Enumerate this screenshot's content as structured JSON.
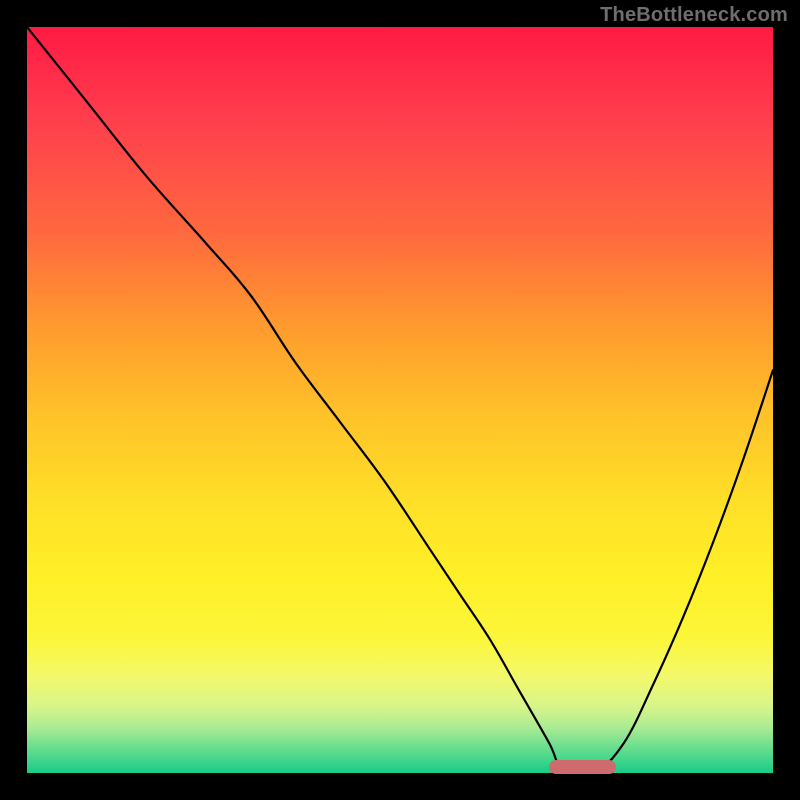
{
  "watermark": "TheBottleneck.com",
  "colors": {
    "background": "#000000",
    "marker": "#cd6b6f",
    "curve": "#000000",
    "gradient_top": "#ff1a44",
    "gradient_bottom": "#18cc88"
  },
  "chart_data": {
    "type": "line",
    "title": "",
    "xlabel": "",
    "ylabel": "",
    "xlim": [
      0,
      100
    ],
    "ylim": [
      0,
      100
    ],
    "series": [
      {
        "name": "bottleneck-curve",
        "x": [
          0,
          8,
          16,
          24,
          30,
          36,
          42,
          48,
          54,
          58,
          62,
          66,
          70,
          72,
          76,
          80,
          84,
          88,
          92,
          96,
          100
        ],
        "values": [
          100,
          90,
          80,
          71,
          64,
          55,
          47,
          39,
          30,
          24,
          18,
          11,
          4,
          0,
          0,
          4,
          12,
          21,
          31,
          42,
          54
        ]
      }
    ],
    "annotations": [
      {
        "name": "optimal-range-marker",
        "x_start": 70,
        "x_end": 79,
        "y": 0
      }
    ]
  }
}
